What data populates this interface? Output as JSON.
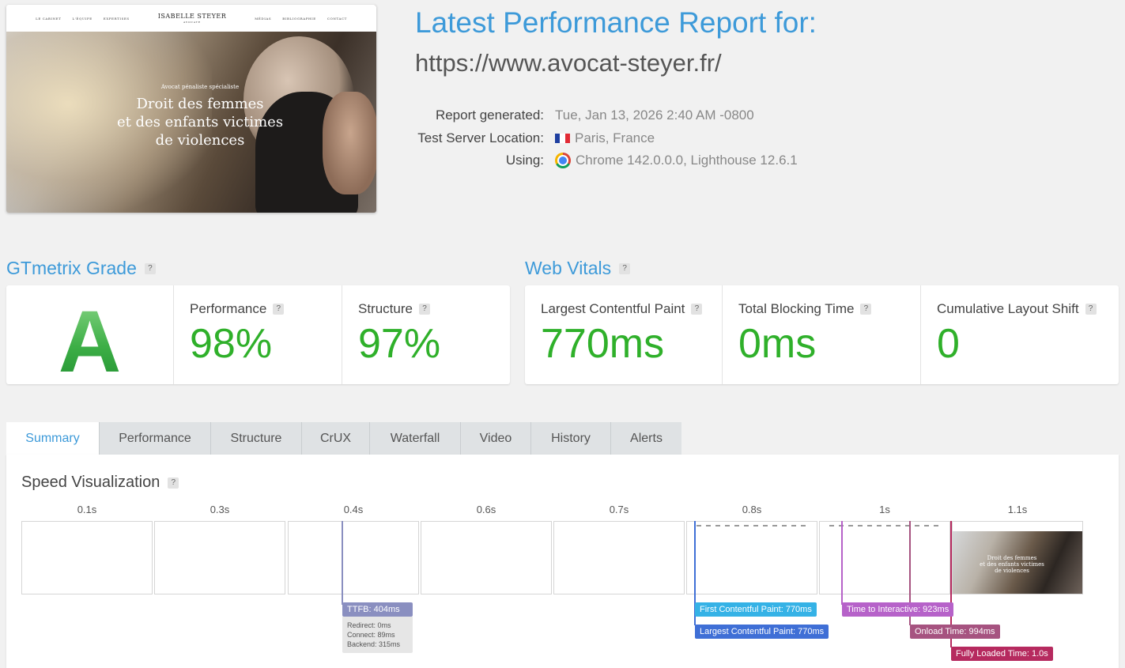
{
  "thumbnail": {
    "nav_left": [
      "LE CABINET",
      "L'ÉQUIPE",
      "EXPERTISES"
    ],
    "brand": "ISABELLE STEYER",
    "brand_sub": "AVOCATE",
    "nav_right": [
      "MÉDIAS",
      "BIBLIOGRAPHIE",
      "CONTACT"
    ],
    "subtitle": "Avocat pénaliste spécialiste",
    "headline_lines": [
      "Droit des femmes",
      "et des enfants victimes",
      "de violences"
    ]
  },
  "header": {
    "title": "Latest Performance Report for:",
    "url": "https://www.avocat-steyer.fr/"
  },
  "meta": {
    "generated_label": "Report generated:",
    "generated_value": "Tue, Jan 13, 2026 2:40 AM -0800",
    "location_label": "Test Server Location:",
    "location_value": "Paris, France",
    "using_label": "Using:",
    "using_value": "Chrome 142.0.0.0, Lighthouse 12.6.1"
  },
  "gtmetrix": {
    "heading": "GTmetrix Grade",
    "help": "?",
    "grade": "A",
    "performance_label": "Performance",
    "performance_value": "98%",
    "structure_label": "Structure",
    "structure_value": "97%"
  },
  "web_vitals": {
    "heading": "Web Vitals",
    "help": "?",
    "lcp_label": "Largest Contentful Paint",
    "lcp_value": "770ms",
    "tbt_label": "Total Blocking Time",
    "tbt_value": "0ms",
    "cls_label": "Cumulative Layout Shift",
    "cls_value": "0"
  },
  "tabs": [
    {
      "label": "Summary",
      "active": true
    },
    {
      "label": "Performance",
      "active": false
    },
    {
      "label": "Structure",
      "active": false
    },
    {
      "label": "CrUX",
      "active": false
    },
    {
      "label": "Waterfall",
      "active": false
    },
    {
      "label": "Video",
      "active": false
    },
    {
      "label": "History",
      "active": false
    },
    {
      "label": "Alerts",
      "active": false
    }
  ],
  "speed": {
    "heading": "Speed Visualization",
    "help": "?",
    "frames": [
      "0.1s",
      "0.3s",
      "0.4s",
      "0.6s",
      "0.7s",
      "0.8s",
      "1s",
      "1.1s"
    ],
    "frame_thumb_lines": [
      "Droit des femmes",
      "et des enfants victimes",
      "de violences"
    ],
    "markers": {
      "ttfb": "TTFB: 404ms",
      "redirect": "Redirect: 0ms",
      "connect": "Connect: 89ms",
      "backend": "Backend: 315ms",
      "fcp": "First Contentful Paint: 770ms",
      "lcp": "Largest Contentful Paint: 770ms",
      "tti": "Time to Interactive: 923ms",
      "onload": "Onload Time: 994ms",
      "fully": "Fully Loaded Time: 1.0s"
    }
  },
  "colors": {
    "accent": "#3d9ad9",
    "good": "#2fb02a",
    "ttfb": "#8a8fc0",
    "fcp": "#35b2e6",
    "lcp": "#3f6fd6",
    "tti": "#b662c9",
    "onload": "#a65380",
    "fully": "#b62a5f"
  }
}
